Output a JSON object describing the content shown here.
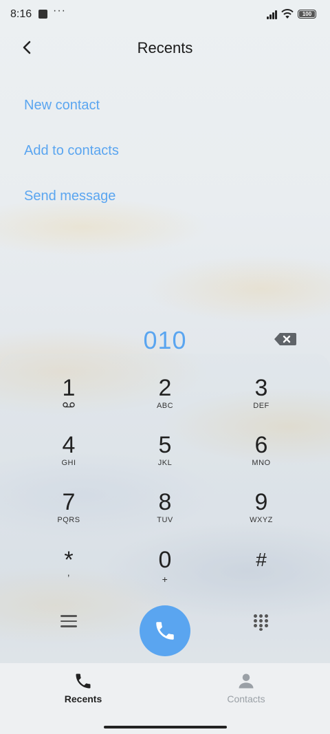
{
  "status_bar": {
    "time": "8:16",
    "more": "···",
    "battery_level": "100"
  },
  "header": {
    "back_icon": "chevron-left-icon",
    "title": "Recents"
  },
  "actions": {
    "new_contact": "New contact",
    "add_to_contacts": "Add to contacts",
    "send_message": "Send message"
  },
  "dialer": {
    "number": "010",
    "backspace_icon": "backspace-icon"
  },
  "keypad": [
    {
      "digit": "1",
      "letters": ""
    },
    {
      "digit": "2",
      "letters": "ABC"
    },
    {
      "digit": "3",
      "letters": "DEF"
    },
    {
      "digit": "4",
      "letters": "GHI"
    },
    {
      "digit": "5",
      "letters": "JKL"
    },
    {
      "digit": "6",
      "letters": "MNO"
    },
    {
      "digit": "7",
      "letters": "PQRS"
    },
    {
      "digit": "8",
      "letters": "TUV"
    },
    {
      "digit": "9",
      "letters": "WXYZ"
    },
    {
      "digit": "*",
      "letters": ","
    },
    {
      "digit": "0",
      "letters": "+"
    },
    {
      "digit": "#",
      "letters": ""
    }
  ],
  "controls": {
    "menu_icon": "menu-icon",
    "call_icon": "phone-icon",
    "dialpad_icon": "dialpad-icon"
  },
  "bottom_nav": [
    {
      "label": "Recents",
      "icon": "phone-icon",
      "active": true
    },
    {
      "label": "Contacts",
      "icon": "person-icon",
      "active": false
    }
  ],
  "colors": {
    "accent": "#5aa5f0",
    "active_tab": "#222222",
    "inactive_tab": "#9aa0a6"
  }
}
